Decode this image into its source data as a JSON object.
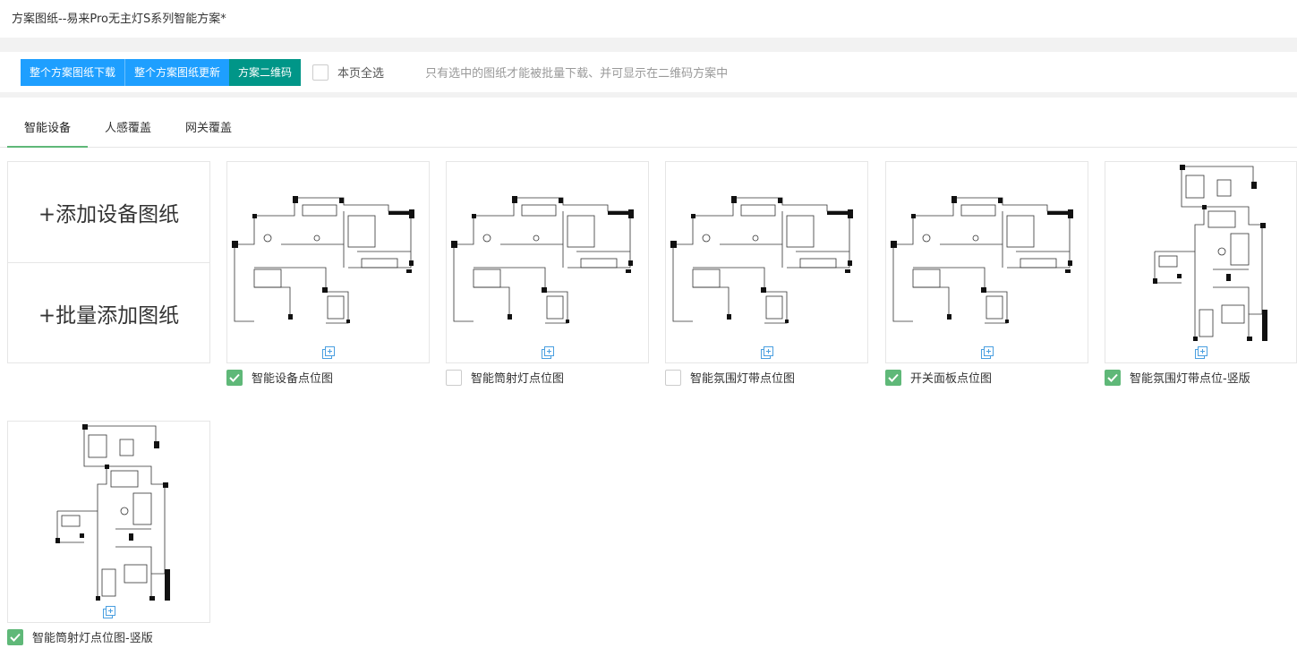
{
  "header": {
    "title": "方案图纸--易来Pro无主灯S系列智能方案*"
  },
  "toolbar": {
    "download_all": "整个方案图纸下载",
    "update_all": "整个方案图纸更新",
    "qrcode": "方案二维码",
    "select_all_label": "本页全选",
    "select_all_checked": false,
    "hint": "只有选中的图纸才能被批量下载、并可显示在二维码方案中"
  },
  "tabs": [
    {
      "label": "智能设备",
      "active": true
    },
    {
      "label": "人感覆盖",
      "active": false
    },
    {
      "label": "网关覆盖",
      "active": false
    }
  ],
  "add_box": {
    "add_device_drawing": "+添加设备图纸",
    "batch_add_drawing": "+批量添加图纸"
  },
  "drawings": [
    {
      "label": "智能设备点位图",
      "checked": true,
      "orientation": "landscape"
    },
    {
      "label": "智能筒射灯点位图",
      "checked": false,
      "orientation": "landscape"
    },
    {
      "label": "智能氛围灯带点位图",
      "checked": false,
      "orientation": "landscape"
    },
    {
      "label": "开关面板点位图",
      "checked": true,
      "orientation": "landscape"
    },
    {
      "label": "智能氛围灯带点位-竖版",
      "checked": true,
      "orientation": "portrait"
    },
    {
      "label": "智能筒射灯点位图-竖版",
      "checked": true,
      "orientation": "portrait"
    }
  ],
  "colors": {
    "primary_blue": "#1e9fff",
    "green": "#009688",
    "check_green": "#5fb878"
  }
}
